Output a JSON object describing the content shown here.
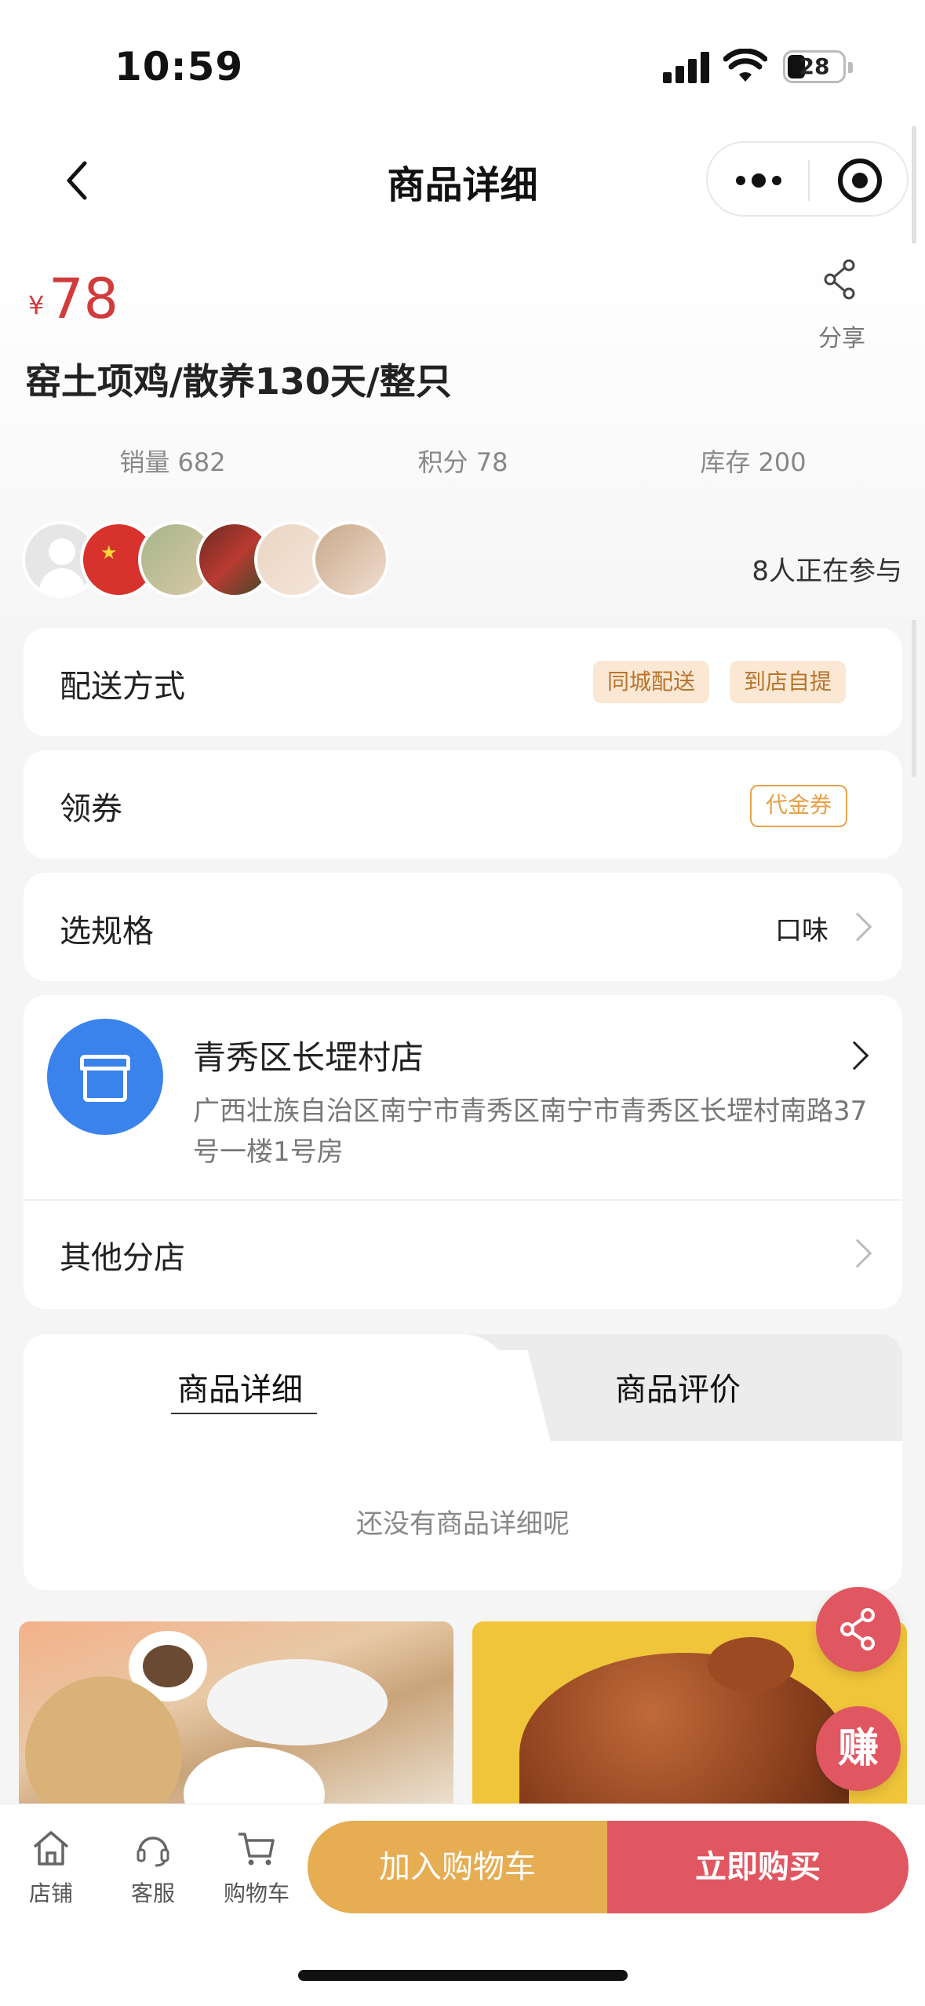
{
  "status_bar": {
    "time": "10:59",
    "battery": "28"
  },
  "nav": {
    "title": "商品详细",
    "back_icon": "chevron-left-icon",
    "more_icon": "more-dots-icon",
    "close_icon": "target-circle-icon"
  },
  "product": {
    "currency": "¥",
    "price": "78",
    "title": "窑土项鸡/散养130天/整只",
    "share_label": "分享",
    "stats": [
      {
        "label": "销量 682"
      },
      {
        "label": "积分 78"
      },
      {
        "label": "库存 200"
      }
    ],
    "participants": "8人正在参与"
  },
  "delivery": {
    "label": "配送方式",
    "tags": [
      "同城配送",
      "到店自提"
    ]
  },
  "coupon": {
    "label": "领券",
    "tag": "代金券"
  },
  "spec": {
    "label": "选规格",
    "value": "口味"
  },
  "store": {
    "name": "青秀区长堽村店",
    "address": "广西壮族自治区南宁市青秀区南宁市青秀区长堽村南路37号一楼1号房",
    "other_label": "其他分店"
  },
  "tabs": {
    "items": [
      {
        "label": "商品详细"
      },
      {
        "label": "商品评价"
      }
    ],
    "empty_text": "还没有商品详细呢"
  },
  "floating": {
    "earn_label": "赚"
  },
  "bottom_bar": {
    "tabs": [
      {
        "label": "店铺",
        "icon": "home-icon"
      },
      {
        "label": "客服",
        "icon": "headset-icon"
      },
      {
        "label": "购物车",
        "icon": "cart-icon"
      }
    ],
    "add_to_cart": "加入购物车",
    "buy_now": "立即购买"
  },
  "colors": {
    "price_red": "#d23b3b",
    "cart_orange": "#e6ad52",
    "buy_red": "#e05761",
    "store_blue": "#3a82ec"
  }
}
